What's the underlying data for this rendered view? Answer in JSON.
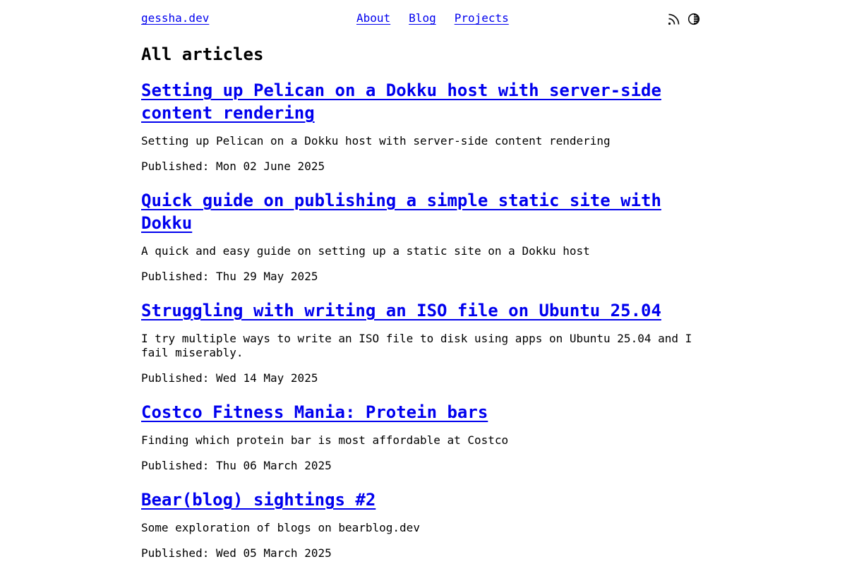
{
  "site": {
    "name": "gessha.dev"
  },
  "nav": {
    "items": [
      "About",
      "Blog",
      "Projects"
    ]
  },
  "icons": {
    "feed": "rss-icon",
    "theme": "theme-toggle-icon"
  },
  "colors": {
    "link": "#0000ee",
    "text": "#000000",
    "background": "#ffffff"
  },
  "page": {
    "title": "All articles"
  },
  "articles": [
    {
      "title": "Setting up Pelican on a Dokku host with server-side content rendering",
      "summary": "Setting up Pelican on a Dokku host with server-side content rendering",
      "published": "Published: Mon 02 June 2025"
    },
    {
      "title": "Quick guide on publishing a simple static site with Dokku",
      "summary": "A quick and easy guide on setting up a static site on a Dokku host",
      "published": "Published: Thu 29 May 2025"
    },
    {
      "title": "Struggling with writing an ISO file on Ubuntu 25.04",
      "summary": "I try multiple ways to write an ISO file to disk using apps on Ubuntu 25.04 and I fail miserably.",
      "published": "Published: Wed 14 May 2025"
    },
    {
      "title": "Costco Fitness Mania: Protein bars",
      "summary": "Finding which protein bar is most affordable at Costco",
      "published": "Published: Thu 06 March 2025"
    },
    {
      "title": "Bear(blog) sightings #2",
      "summary": "Some exploration of blogs on bearblog.dev",
      "published": "Published: Wed 05 March 2025"
    }
  ]
}
